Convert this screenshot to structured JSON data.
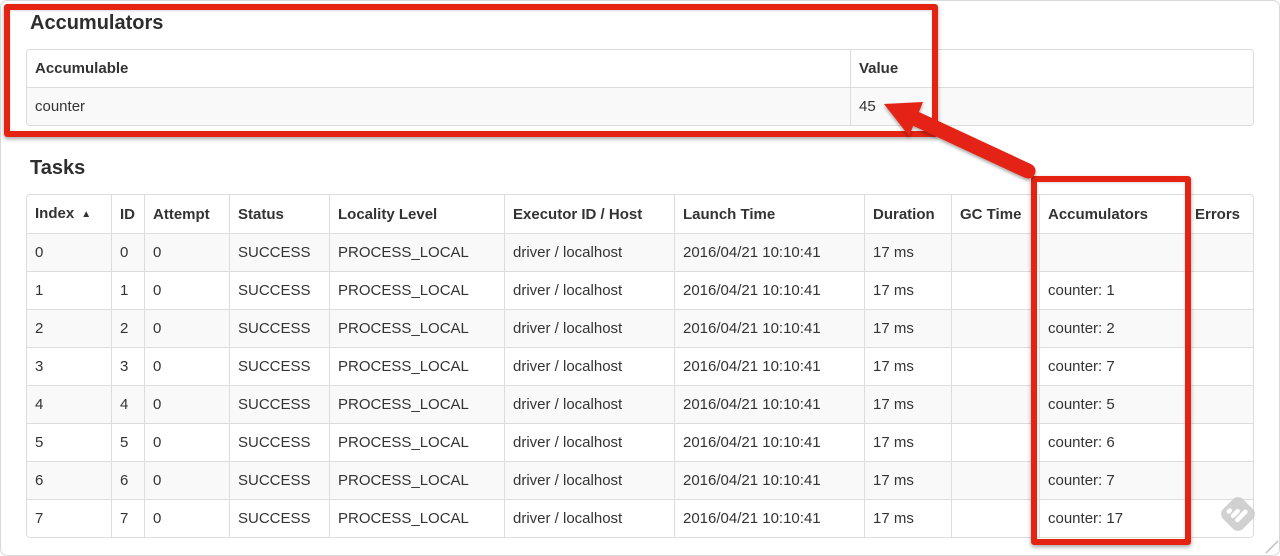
{
  "accumulators_section": {
    "title": "Accumulators",
    "table": {
      "headers": [
        "Accumulable",
        "Value"
      ],
      "rows": [
        [
          "counter",
          "45"
        ]
      ]
    }
  },
  "tasks_section": {
    "title": "Tasks",
    "table": {
      "headers": [
        "Index",
        "ID",
        "Attempt",
        "Status",
        "Locality Level",
        "Executor ID / Host",
        "Launch Time",
        "Duration",
        "GC Time",
        "Accumulators",
        "Errors"
      ],
      "sort": {
        "column": 0,
        "icon": "▲",
        "direction": "ascending"
      },
      "rows": [
        [
          "0",
          "0",
          "0",
          "SUCCESS",
          "PROCESS_LOCAL",
          "driver / localhost",
          "2016/04/21 10:10:41",
          "17 ms",
          "",
          "",
          ""
        ],
        [
          "1",
          "1",
          "0",
          "SUCCESS",
          "PROCESS_LOCAL",
          "driver / localhost",
          "2016/04/21 10:10:41",
          "17 ms",
          "",
          "counter: 1",
          ""
        ],
        [
          "2",
          "2",
          "0",
          "SUCCESS",
          "PROCESS_LOCAL",
          "driver / localhost",
          "2016/04/21 10:10:41",
          "17 ms",
          "",
          "counter: 2",
          ""
        ],
        [
          "3",
          "3",
          "0",
          "SUCCESS",
          "PROCESS_LOCAL",
          "driver / localhost",
          "2016/04/21 10:10:41",
          "17 ms",
          "",
          "counter: 7",
          ""
        ],
        [
          "4",
          "4",
          "0",
          "SUCCESS",
          "PROCESS_LOCAL",
          "driver / localhost",
          "2016/04/21 10:10:41",
          "17 ms",
          "",
          "counter: 5",
          ""
        ],
        [
          "5",
          "5",
          "0",
          "SUCCESS",
          "PROCESS_LOCAL",
          "driver / localhost",
          "2016/04/21 10:10:41",
          "17 ms",
          "",
          "counter: 6",
          ""
        ],
        [
          "6",
          "6",
          "0",
          "SUCCESS",
          "PROCESS_LOCAL",
          "driver / localhost",
          "2016/04/21 10:10:41",
          "17 ms",
          "",
          "counter: 7",
          ""
        ],
        [
          "7",
          "7",
          "0",
          "SUCCESS",
          "PROCESS_LOCAL",
          "driver / localhost",
          "2016/04/21 10:10:41",
          "17 ms",
          "",
          "counter: 17",
          ""
        ]
      ]
    }
  },
  "annotations": {
    "highlight_color": "#e42312",
    "boxes": [
      "accumulators-summary",
      "accumulators-task-column"
    ],
    "arrow_target_value": "45"
  },
  "colors": {
    "table_border": "#dddddd",
    "stripe_row": "#f9f9f9",
    "text": "#333333",
    "watermark_gray": "#c9c9c9"
  }
}
